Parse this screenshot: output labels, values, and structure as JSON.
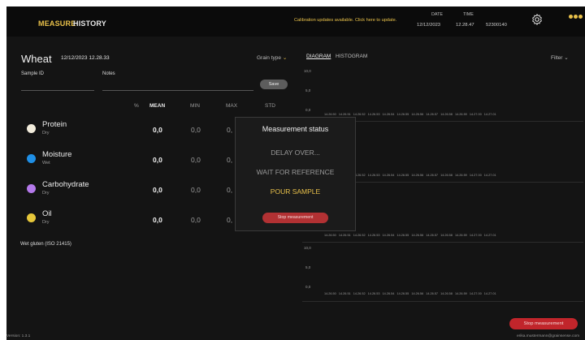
{
  "nav": {
    "measure": "MEASURE",
    "history": "HISTORY"
  },
  "calibration_notice": "Calibration updates available. Click here to update.",
  "meta": {
    "date_label": "DATE",
    "date": "12/12/2023",
    "time_label": "TIME",
    "time": "12.28.47",
    "serial": "52300140"
  },
  "sample": {
    "grain": "Wheat",
    "datetime": "12/12/2023 12.28.33",
    "sample_id_label": "Sample ID",
    "notes_label": "Notes",
    "save_label": "Save"
  },
  "table": {
    "headers": [
      "%",
      "MEAN",
      "MIN",
      "MAX",
      "STD"
    ],
    "rows": [
      {
        "name": "Protein",
        "sub": "Dry",
        "color": "#f2ecdc",
        "mean": "0,0",
        "min": "0,0",
        "max": "0,"
      },
      {
        "name": "Moisture",
        "sub": "Wet",
        "color": "#1f8fe6",
        "mean": "0,0",
        "min": "0,0",
        "max": "0,"
      },
      {
        "name": "Carbohydrate",
        "sub": "Dry",
        "color": "#b479ea",
        "mean": "0,0",
        "min": "0,0",
        "max": "0,"
      },
      {
        "name": "Oil",
        "sub": "Dry",
        "color": "#e6c73a",
        "mean": "0,0",
        "min": "0,0",
        "max": "0,"
      }
    ],
    "wet_gluten": "Wet gluten (ISO 21415)"
  },
  "dialog": {
    "title": "Measurement status",
    "steps": [
      "DELAY OVER...",
      "WAIT FOR REFERENCE",
      "POUR SAMPLE"
    ],
    "stop_label": "Stop measurement"
  },
  "charts": {
    "grain_type": "Grain type",
    "tab_diagram": "DIAGRAM",
    "tab_histogram": "HISTOGRAM",
    "filter": "Filter",
    "y_ticks": [
      "10,0",
      "5,0",
      "0,0"
    ],
    "x_ticks": [
      "14.26.50",
      "14.26.51",
      "14.26.52",
      "14.26.53",
      "14.26.54",
      "14.26.55",
      "14.26.56",
      "14.26.57",
      "14.26.58",
      "14.26.59",
      "14.27.00",
      "14.27.01"
    ]
  },
  "footer": {
    "stop_label": "Stop measurement",
    "version": "Version: 1.3.1",
    "email": "erika.mustermann@grainsense.com"
  },
  "colors": {
    "accent": "#e9c14a",
    "stop": "#c1252b"
  }
}
